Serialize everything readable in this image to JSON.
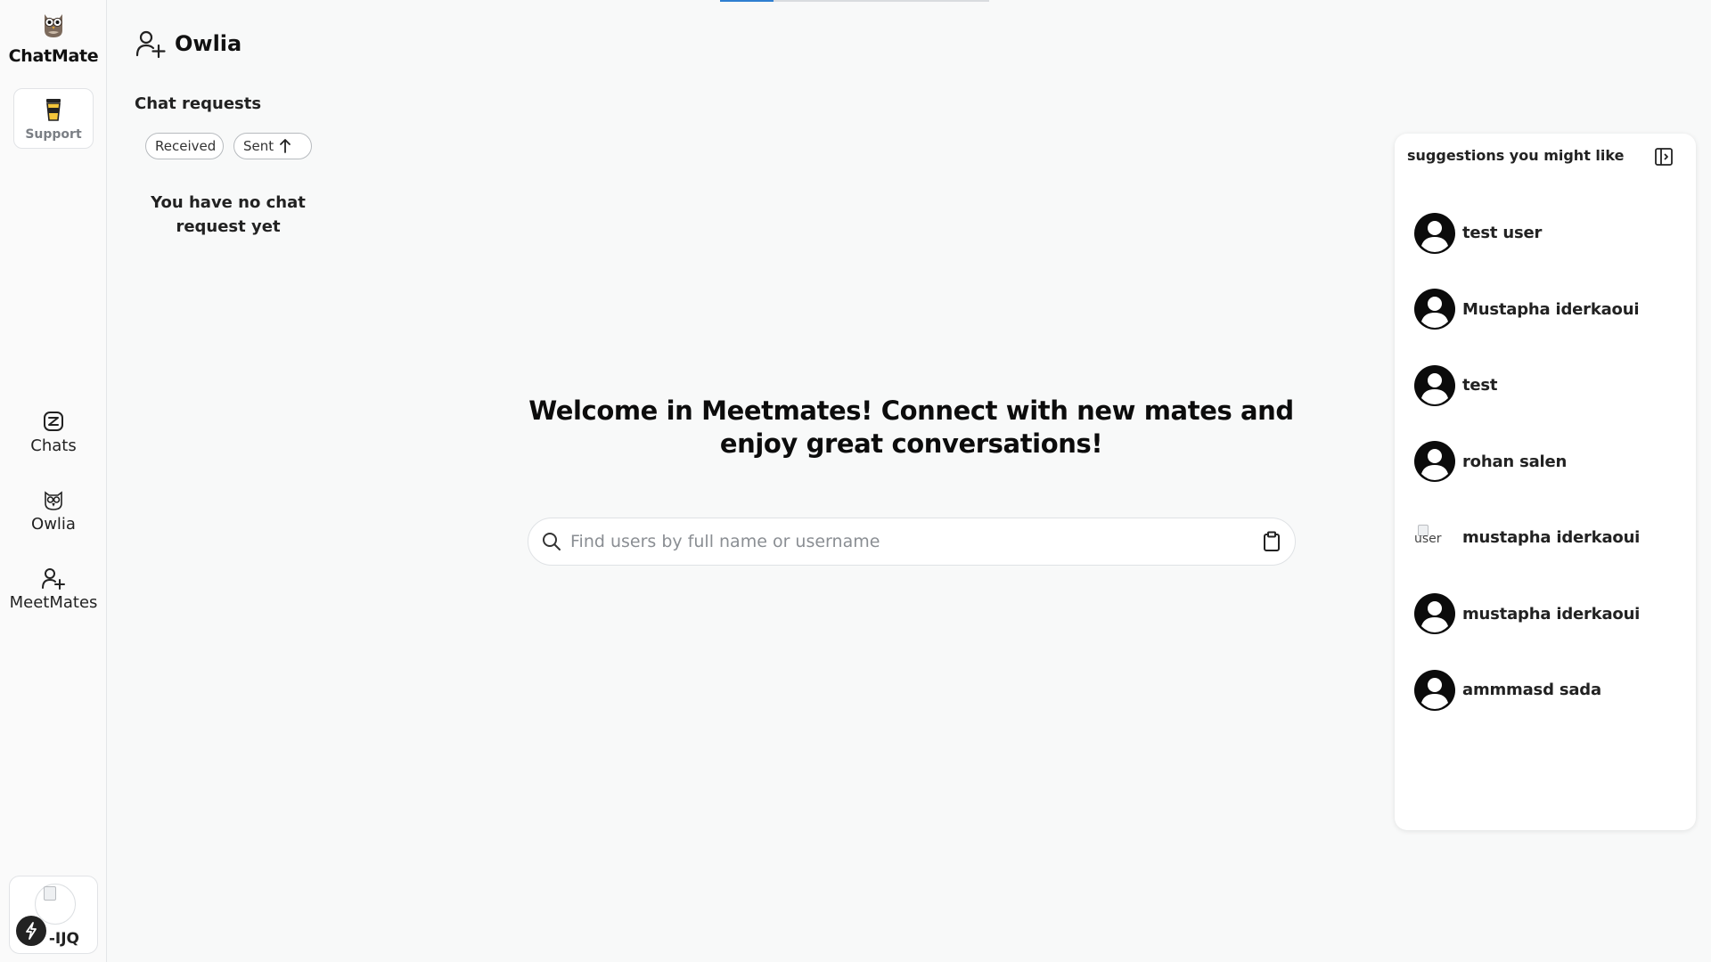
{
  "top_progress": {
    "fraction": 0.2
  },
  "sidebar": {
    "brand": "ChatMate",
    "support_label": "Support",
    "nav": [
      {
        "label": "Chats",
        "icon": "chats-icon"
      },
      {
        "label": "Owlia",
        "icon": "owl-icon"
      },
      {
        "label": "MeetMates",
        "icon": "add-user-icon"
      }
    ],
    "profile_label": "-IJQ"
  },
  "header": {
    "title": "Owlia"
  },
  "requests": {
    "title": "Chat requests",
    "tabs": [
      {
        "label": "Received"
      },
      {
        "label": "Sent"
      }
    ],
    "empty_message": "You have no chat request yet"
  },
  "main": {
    "welcome": "Welcome in Meetmates! Connect with new mates and enjoy great conversations!",
    "search": {
      "placeholder": "Find users by full name or username",
      "value": ""
    }
  },
  "suggestions": {
    "title": "suggestions you might like",
    "items": [
      {
        "name": "test user",
        "avatar": "default"
      },
      {
        "name": "Mustapha iderkaoui",
        "avatar": "default"
      },
      {
        "name": "test",
        "avatar": "default"
      },
      {
        "name": "rohan salen",
        "avatar": "default"
      },
      {
        "name": "mustapha iderkaoui",
        "avatar": "broken",
        "alt": "user"
      },
      {
        "name": "mustapha iderkaoui",
        "avatar": "default"
      },
      {
        "name": "ammmasd sada",
        "avatar": "default"
      }
    ]
  }
}
